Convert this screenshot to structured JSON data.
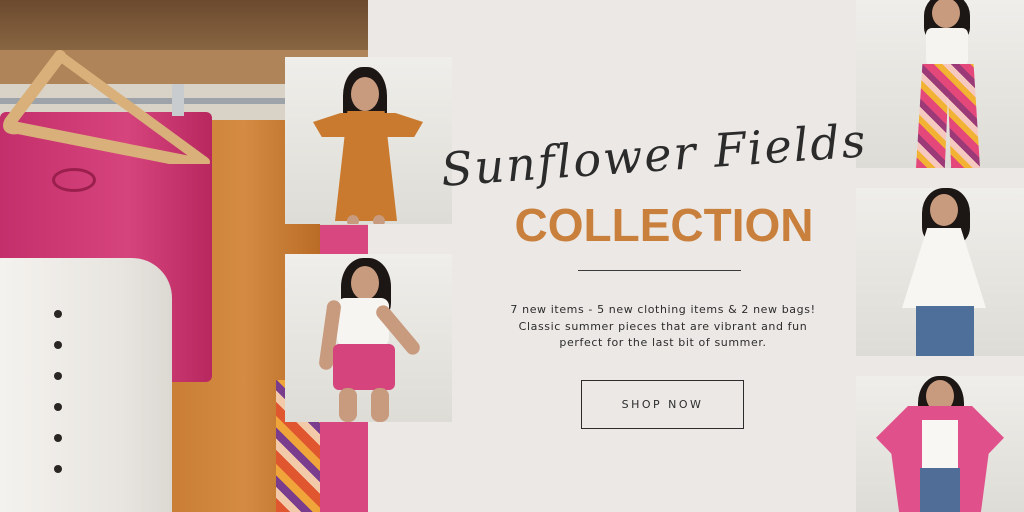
{
  "banner": {
    "script_title": "Sunflower Fields",
    "collection_title": "COLLECTION",
    "description": "7 new items - 5 new clothing items & 2 new bags! Classic summer pieces that are vibrant and fun perfect for the last bit of summer.",
    "cta_label": "SHOP NOW"
  },
  "colors": {
    "background": "#ece8e6",
    "accent_orange": "#c9803d",
    "text_dark": "#2c2c2c",
    "pink": "#d6447d"
  },
  "images": {
    "rack": "clothing-rack-photo",
    "dress": "model-orange-dress-photo",
    "shorts": "model-pink-shorts-photo",
    "pants": "model-floral-pants-photo",
    "peplum": "model-white-peplum-top-photo",
    "cardigan": "model-pink-cardigan-photo"
  }
}
